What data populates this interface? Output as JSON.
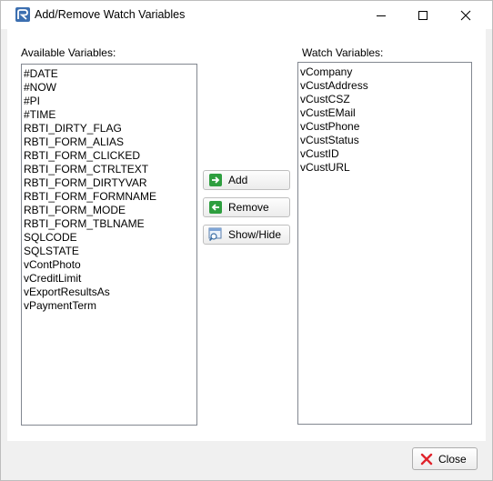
{
  "window": {
    "title": "Add/Remove Watch Variables",
    "icons": {
      "app": "app-logo-icon",
      "minimize": "minimize-icon",
      "maximize": "maximize-icon",
      "close": "close-icon"
    }
  },
  "available": {
    "label": "Available Variables:",
    "items": [
      "#DATE",
      "#NOW",
      "#PI",
      "#TIME",
      "RBTI_DIRTY_FLAG",
      "RBTI_FORM_ALIAS",
      "RBTI_FORM_CLICKED",
      "RBTI_FORM_CTRLTEXT",
      "RBTI_FORM_DIRTYVAR",
      "RBTI_FORM_FORMNAME",
      "RBTI_FORM_MODE",
      "RBTI_FORM_TBLNAME",
      "SQLCODE",
      "SQLSTATE",
      "vContPhoto",
      "vCreditLimit",
      "vExportResultsAs",
      "vPaymentTerm"
    ]
  },
  "watch": {
    "label": "Watch Variables:",
    "items": [
      "vCompany",
      "vCustAddress",
      "vCustCSZ",
      "vCustEMail",
      "vCustPhone",
      "vCustStatus",
      "vCustID",
      "vCustURL"
    ]
  },
  "buttons": {
    "add": "Add",
    "remove": "Remove",
    "show_hide": "Show/Hide",
    "close": "Close"
  },
  "colors": {
    "add_green": "#2e9e3f",
    "remove_green": "#2e9e3f",
    "close_red": "#e0232b"
  }
}
